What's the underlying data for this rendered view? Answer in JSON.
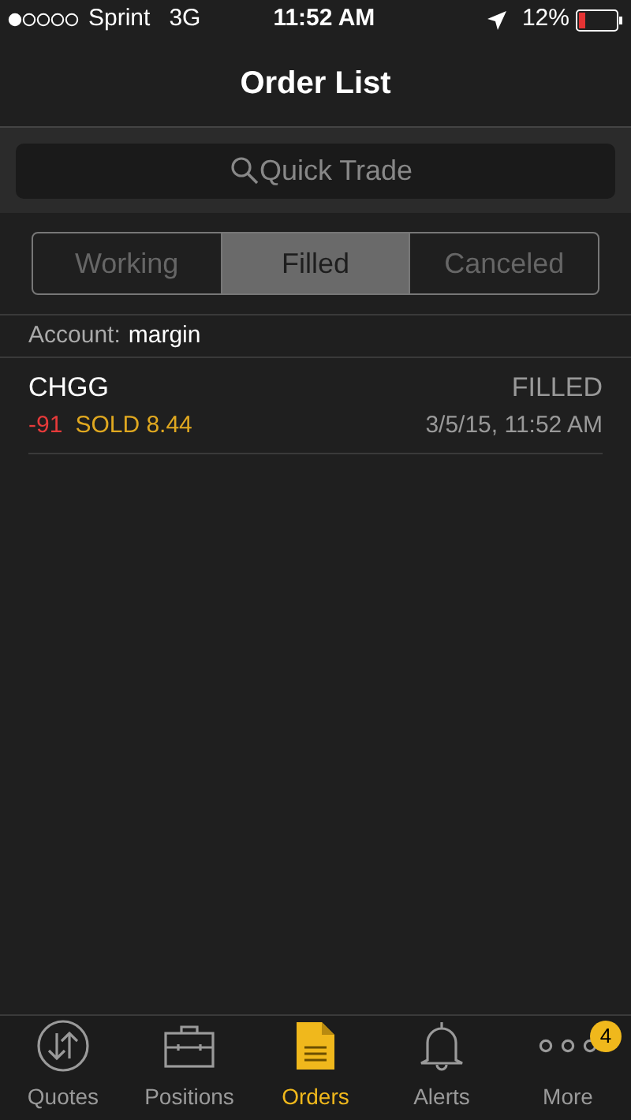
{
  "status_bar": {
    "carrier": "Sprint",
    "network": "3G",
    "time": "11:52 AM",
    "battery": "12%"
  },
  "title": "Order List",
  "search": {
    "placeholder": "Quick Trade"
  },
  "segments": [
    {
      "label": "Working",
      "selected": false
    },
    {
      "label": "Filled",
      "selected": true
    },
    {
      "label": "Canceled",
      "selected": false
    }
  ],
  "account": {
    "label": "Account:",
    "value": "margin"
  },
  "orders": [
    {
      "symbol": "CHGG",
      "status": "FILLED",
      "quantity": "-91",
      "action": "SOLD 8.44",
      "time": "3/5/15, 11:52 AM"
    }
  ],
  "tab_bar": [
    {
      "kind": "quotes",
      "label": "Quotes",
      "selected": false
    },
    {
      "kind": "positions",
      "label": "Positions",
      "selected": false
    },
    {
      "kind": "orders",
      "label": "Orders",
      "selected": true
    },
    {
      "kind": "alerts",
      "label": "Alerts",
      "selected": false
    },
    {
      "kind": "more",
      "label": "More",
      "selected": false,
      "badge": "4"
    }
  ]
}
